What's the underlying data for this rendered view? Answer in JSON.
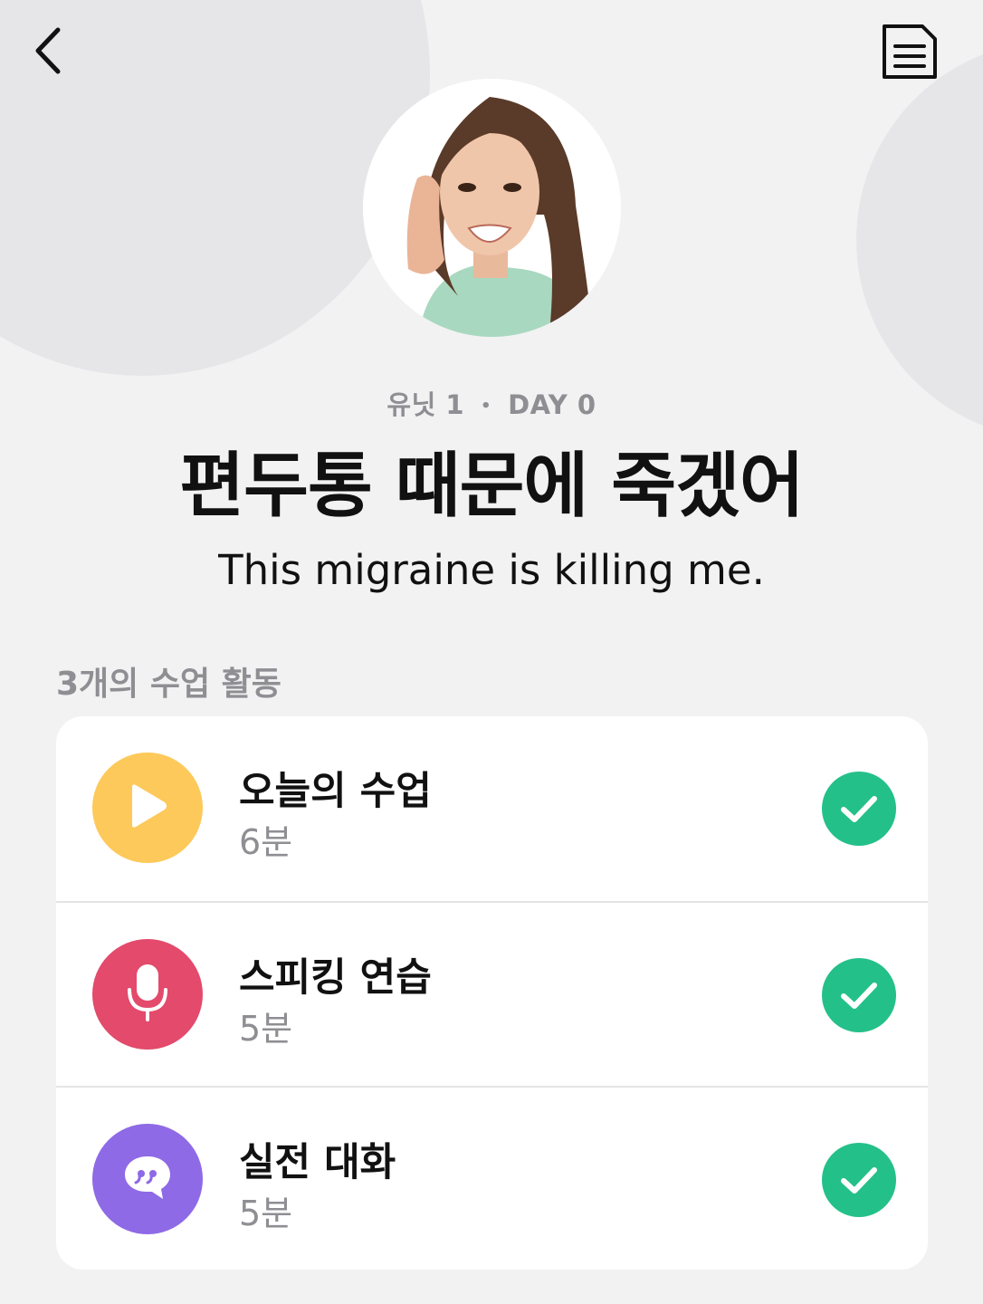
{
  "colors": {
    "background": "#f2f2f3",
    "bg_circle": "#e6e6e9",
    "card": "#ffffff",
    "check": "#24c08a",
    "muted_text": "#8e8e93"
  },
  "header": {
    "back_icon": "chevron-left-icon",
    "doc_icon": "document-icon"
  },
  "lesson": {
    "unit": "유닛 1",
    "separator": "•",
    "day": "DAY 0",
    "title_ko": "편두통 때문에 죽겠어",
    "title_en": "This migraine is killing me."
  },
  "section_label": "3개의 수업 활동",
  "activities": [
    {
      "title": "오늘의 수업",
      "duration": "6분",
      "icon": "play-icon",
      "color": "#fdc95a",
      "completed": true
    },
    {
      "title": "스피킹 연습",
      "duration": "5분",
      "icon": "microphone-icon",
      "color": "#e34a6b",
      "completed": true
    },
    {
      "title": "실전 대화",
      "duration": "5분",
      "icon": "chat-quote-icon",
      "color": "#8e6ae6",
      "completed": true
    }
  ]
}
